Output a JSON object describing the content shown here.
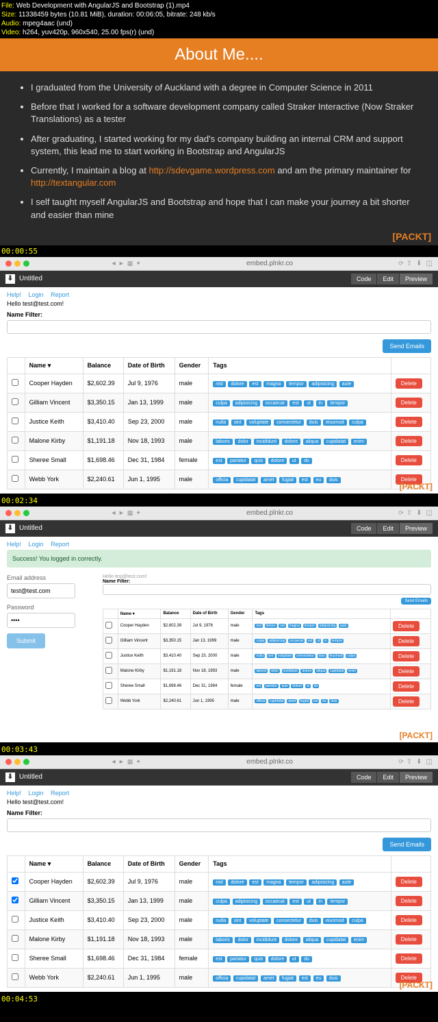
{
  "meta": {
    "file_label": "File:",
    "file": "Web Development with AngularJS and Bootstrap (1).mp4",
    "size_label": "Size:",
    "size": "11338459 bytes (10.81 MiB), duration: 00:06:05, bitrate: 248 kb/s",
    "audio_label": "Audio:",
    "audio": "mpeg4aac (und)",
    "video_label": "Video:",
    "video": "h264, yuv420p, 960x540, 25.00 fps(r) (und)"
  },
  "slide": {
    "title": "About Me....",
    "bullets": [
      "I graduated from the University of Auckland with a degree in Computer Science in 2011",
      "Before that I worked for a software development company called Straker Interactive (Now Straker Translations) as a tester",
      "After graduating, I started working for my dad's company building an internal CRM and support system, this lead me to start working in Bootstrap and AngularJS",
      "Currently, I maintain a blog at http://sdevgame.wordpress.com and am the primary maintainer for http://textangular.com",
      "I self taught myself AngularJS and Bootstrap and hope that I can make your journey a bit shorter and easier than mine"
    ],
    "link1": "http://sdevgame.wordpress.com",
    "link2": "http://textangular.com"
  },
  "timestamps": [
    "00:00:55",
    "00:02:34",
    "00:03:43",
    "00:04:53"
  ],
  "browser": {
    "url": "embed.plnkr.co",
    "untitled": "Untitled",
    "tabs": {
      "code": "Code",
      "edit": "Edit",
      "preview": "Preview"
    }
  },
  "app": {
    "help": "Help!",
    "nav": {
      "login": "Login",
      "report": "Report"
    },
    "hello": "Hello test@test.com!",
    "filter_label": "Name Filter:",
    "send_emails": "Send Emails",
    "columns": {
      "name": "Name",
      "balance": "Balance",
      "dob": "Date of Birth",
      "gender": "Gender",
      "tags": "Tags"
    },
    "delete": "Delete",
    "rows": [
      {
        "name": "Cooper Hayden",
        "balance": "$2,602.39",
        "dob": "Jul 9, 1976",
        "gender": "male",
        "tags": [
          "nisl",
          "dolore",
          "est",
          "magna",
          "tempor",
          "adipisicing",
          "aute"
        ]
      },
      {
        "name": "Gilliam Vincent",
        "balance": "$3,350.15",
        "dob": "Jan 13, 1999",
        "gender": "male",
        "tags": [
          "culpa",
          "adipisicing",
          "occaecat",
          "est",
          "ut",
          "in",
          "tempor"
        ]
      },
      {
        "name": "Justice Keith",
        "balance": "$3,410.40",
        "dob": "Sep 23, 2000",
        "gender": "male",
        "tags": [
          "nulla",
          "sint",
          "voluptate",
          "consectetur",
          "duis",
          "eiusmod",
          "culpa"
        ]
      },
      {
        "name": "Malone Kirby",
        "balance": "$1,191.18",
        "dob": "Nov 18, 1993",
        "gender": "male",
        "tags": [
          "laboris",
          "dolor",
          "incididunt",
          "dolore",
          "aliqua",
          "cupidatat",
          "enim"
        ]
      },
      {
        "name": "Sheree Small",
        "balance": "$1,698.46",
        "dob": "Dec 31, 1984",
        "gender": "female",
        "tags": [
          "est",
          "pariatur",
          "quis",
          "dolore",
          "ut",
          "do"
        ]
      },
      {
        "name": "Webb York",
        "balance": "$2,240.61",
        "dob": "Jun 1, 1995",
        "gender": "male",
        "tags": [
          "officia",
          "cupidatat",
          "amet",
          "fugiat",
          "est",
          "eu",
          "duis"
        ]
      }
    ]
  },
  "login": {
    "success": "Success! You logged in correctly.",
    "email_label": "Email address",
    "email_value": "test@test.com",
    "password_label": "Password",
    "password_value": "••••",
    "submit": "Submit",
    "hello_mini": "Hello test@test.com!",
    "filter_mini": "Name Filter:"
  },
  "packt": "[PACKT]"
}
